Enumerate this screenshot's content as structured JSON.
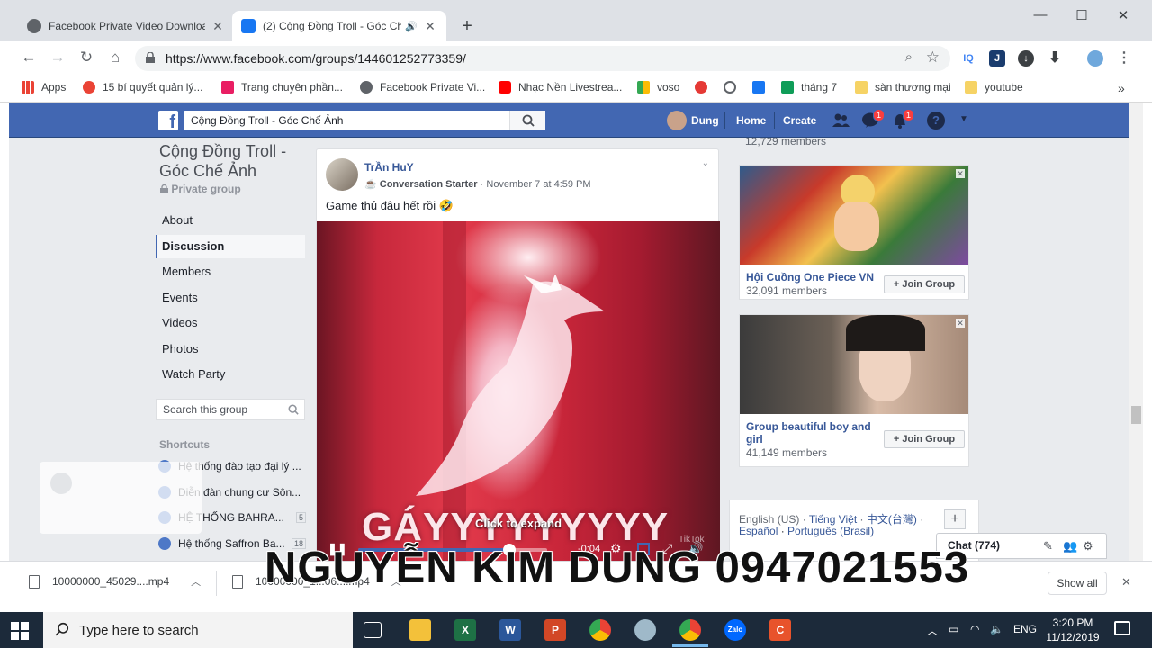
{
  "browser": {
    "tabs": [
      {
        "title": "Facebook Private Video Downloa",
        "favicon_color": "#5f6368",
        "active": false
      },
      {
        "title": "(2) Cộng Đồng Troll - Góc Ch",
        "favicon_color": "#1877f2",
        "active": true
      }
    ],
    "url": "https://www.facebook.com/groups/144601252773359/",
    "bookmarks": [
      {
        "label": "Apps",
        "icon": "apps-grid-icon",
        "color": "#4285f4"
      },
      {
        "label": "15 bí quyết quản lý...",
        "icon": "colorful-dots-icon",
        "color": "#ea4335"
      },
      {
        "label": "Trang chuyên phần...",
        "icon": "t-icon",
        "color": "#e91e63"
      },
      {
        "label": "Facebook Private Vi...",
        "icon": "globe-icon",
        "color": "#5f6368"
      },
      {
        "label": "Nhạc Nền Livestrea...",
        "icon": "youtube-icon",
        "color": "#ff0000"
      },
      {
        "label": "voso",
        "icon": "voso-icon",
        "color": "#34a853"
      },
      {
        "label": "",
        "icon": "red-shield-icon",
        "color": "#e53935"
      },
      {
        "label": "",
        "icon": "dollar-icon",
        "color": "#5f6368"
      },
      {
        "label": "",
        "icon": "facebook-icon",
        "color": "#1877f2"
      },
      {
        "label": "tháng 7",
        "icon": "plus-sheet-icon",
        "color": "#0f9d58"
      },
      {
        "label": "sàn thương mại",
        "icon": "folder-icon",
        "color": "#f6d365"
      },
      {
        "label": "youtube",
        "icon": "folder-icon",
        "color": "#f6d365"
      }
    ]
  },
  "facebook": {
    "search_value": "Cộng Đồng Troll - Góc Chế Ảnh",
    "user_name": "Dung",
    "nav_home": "Home",
    "nav_create": "Create",
    "messages_badge": "1",
    "notifications_badge": "1"
  },
  "group": {
    "name": "Cộng Đồng Troll - Góc Chế Ảnh",
    "privacy": "Private group",
    "nav": [
      "About",
      "Discussion",
      "Members",
      "Events",
      "Videos",
      "Photos",
      "Watch Party"
    ],
    "selected_nav": "Discussion",
    "search_placeholder": "Search this group",
    "shortcuts_title": "Shortcuts",
    "shortcuts": [
      {
        "label": "Hệ thống đào tạo đại lý ...",
        "count": ""
      },
      {
        "label": "Diễn đàn chung cư Sôn...",
        "count": ""
      },
      {
        "label": "HỆ THỐNG BAHRA...",
        "count": "5"
      },
      {
        "label": "Hệ thống Saffron Ba...",
        "count": "18"
      }
    ]
  },
  "post": {
    "author": "TrẦn HuY",
    "badge": "Conversation Starter",
    "time": "November 7 at 4:59 PM",
    "text": "Game thủ đâu hết rồi 🤣",
    "video": {
      "caption": "GÁYYYYYYYYY",
      "expand_hint": "Click to expand",
      "time_remaining": "-0:04",
      "progress": 0.8,
      "watermark": "TikTok"
    }
  },
  "sidebar": {
    "top_members": "12,729 members",
    "suggested_groups": [
      {
        "name": "Hội Cuồng One Piece VN",
        "members": "32,091 members",
        "join_label": "Join Group"
      },
      {
        "name": "Group beautiful boy and girl",
        "members": "41,149 members",
        "join_label": "Join Group"
      }
    ],
    "languages_line1": [
      "English (US)",
      "Tiếng Việt",
      "中文(台灣)"
    ],
    "languages_line2": [
      "Español",
      "Português (Brasil)"
    ],
    "chat_label": "Chat (774)"
  },
  "downloads": {
    "items": [
      "10000000_45029....mp4",
      "10000000_1...06....mp4"
    ],
    "show_all": "Show all"
  },
  "overlay": {
    "text": "NGUYỄN KIM DUNG 0947021553"
  },
  "taskbar": {
    "search_placeholder": "Type here to search",
    "language": "ENG",
    "time": "3:20 PM",
    "date": "11/12/2019"
  }
}
